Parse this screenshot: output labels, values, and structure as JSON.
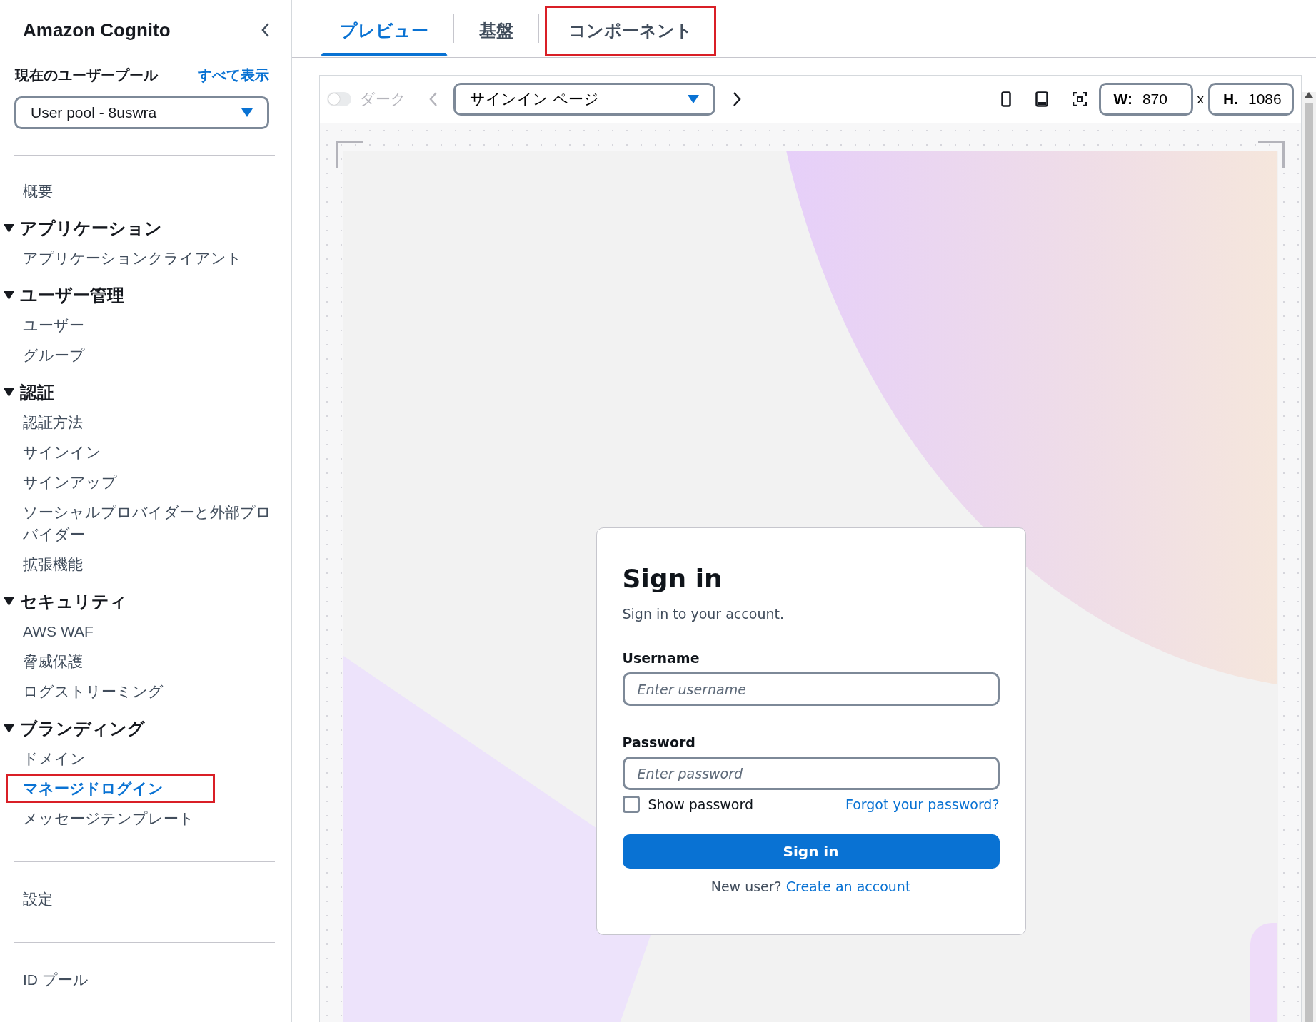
{
  "sidebar": {
    "title": "Amazon Cognito",
    "pool_label": "現在のユーザープール",
    "view_all_link": "すべて表示",
    "pool_select": {
      "value": "User pool - 8uswra"
    },
    "nav": [
      {
        "kind": "link",
        "label": "概要",
        "selected": false,
        "highlighted": false
      },
      {
        "kind": "section",
        "label": "アプリケーション",
        "expanded": true,
        "children": [
          {
            "kind": "link",
            "label": "アプリケーションクライアント",
            "selected": false,
            "highlighted": false
          }
        ]
      },
      {
        "kind": "section",
        "label": "ユーザー管理",
        "expanded": true,
        "children": [
          {
            "kind": "link",
            "label": "ユーザー",
            "selected": false,
            "highlighted": false
          },
          {
            "kind": "link",
            "label": "グループ",
            "selected": false,
            "highlighted": false
          }
        ]
      },
      {
        "kind": "section",
        "label": "認証",
        "expanded": true,
        "children": [
          {
            "kind": "link",
            "label": "認証方法",
            "selected": false,
            "highlighted": false
          },
          {
            "kind": "link",
            "label": "サインイン",
            "selected": false,
            "highlighted": false
          },
          {
            "kind": "link",
            "label": "サインアップ",
            "selected": false,
            "highlighted": false
          },
          {
            "kind": "link",
            "label": "ソーシャルプロバイダーと外部プロバイダー",
            "selected": false,
            "highlighted": false
          },
          {
            "kind": "link",
            "label": "拡張機能",
            "selected": false,
            "highlighted": false
          }
        ]
      },
      {
        "kind": "section",
        "label": "セキュリティ",
        "expanded": true,
        "children": [
          {
            "kind": "link",
            "label": "AWS WAF",
            "selected": false,
            "highlighted": false
          },
          {
            "kind": "link",
            "label": "脅威保護",
            "selected": false,
            "highlighted": false
          },
          {
            "kind": "link",
            "label": "ログストリーミング",
            "selected": false,
            "highlighted": false
          }
        ]
      },
      {
        "kind": "section",
        "label": "ブランディング",
        "expanded": true,
        "children": [
          {
            "kind": "link",
            "label": "ドメイン",
            "selected": false,
            "highlighted": false
          },
          {
            "kind": "link",
            "label": "マネージドログイン",
            "selected": true,
            "highlighted": true
          },
          {
            "kind": "link",
            "label": "メッセージテンプレート",
            "selected": false,
            "highlighted": false
          }
        ]
      }
    ],
    "footer_nav": [
      {
        "label": "設定",
        "selected": false
      },
      {
        "label": "ID プール",
        "selected": false
      }
    ]
  },
  "tabs": [
    {
      "label": "プレビュー",
      "selected": true,
      "highlighted": false
    },
    {
      "label": "基盤",
      "selected": false,
      "highlighted": false
    },
    {
      "label": "コンポーネント",
      "selected": false,
      "highlighted": true
    }
  ],
  "toolbar": {
    "dark_toggle": {
      "label": "ダーク",
      "on": false,
      "disabled": true
    },
    "prev_button": {
      "disabled": true
    },
    "page_select": {
      "value": "サインイン ページ"
    },
    "width_field": {
      "label": "W:",
      "value": "870"
    },
    "separator": "x",
    "height_field": {
      "label": "H.",
      "value": "1086"
    }
  },
  "signin_card": {
    "title": "Sign in",
    "subtitle": "Sign in to your account.",
    "fields": [
      {
        "label": "Username",
        "placeholder": "Enter username"
      },
      {
        "label": "Password",
        "placeholder": "Enter password"
      }
    ],
    "show_password": {
      "label": "Show password",
      "checked": false
    },
    "forgot_link": "Forgot your password?",
    "submit_button": "Sign in",
    "signup_prompt": "New user?",
    "signup_link": "Create an account"
  }
}
